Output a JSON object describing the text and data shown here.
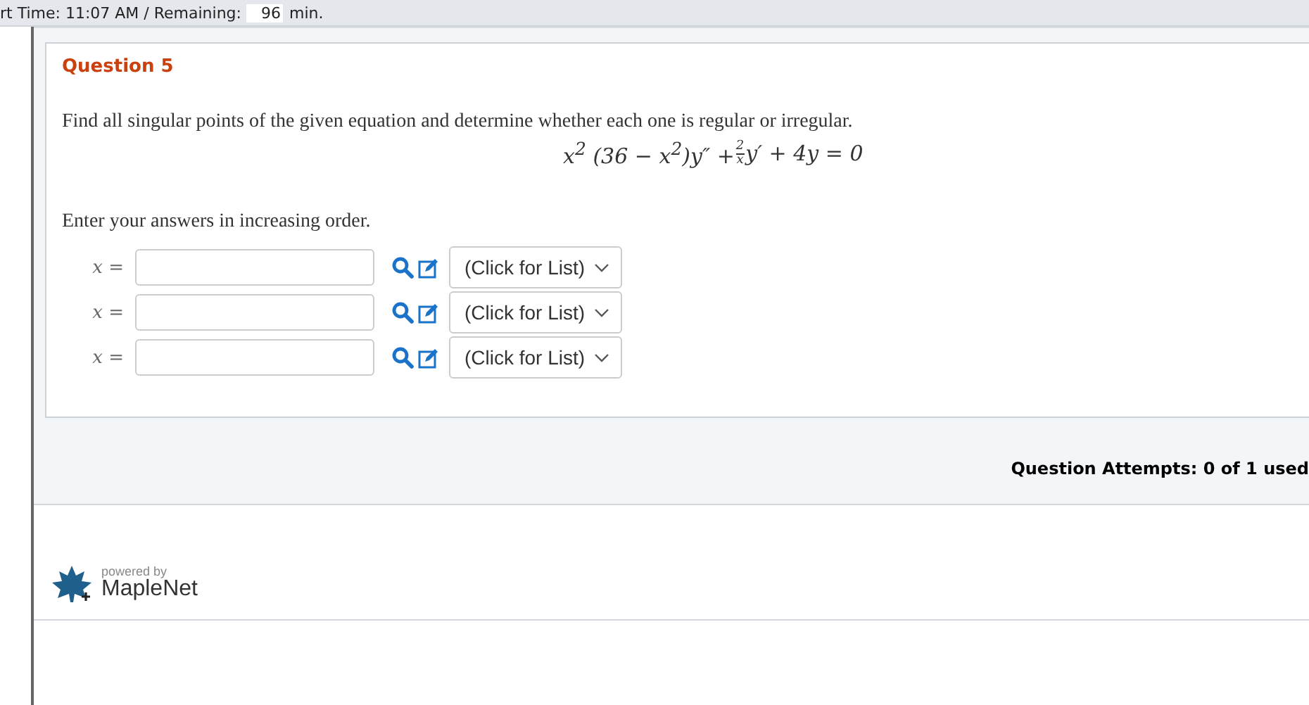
{
  "top_bar": {
    "time_label": "rt Time: 11:07 AM / Remaining:",
    "remaining": "96",
    "unit": "min."
  },
  "question": {
    "title": "Question 5",
    "prompt": "Find all singular points of the given equation and determine whether each one is regular or irregular.",
    "equation": {
      "before": "x$^{2}$ (36 − x$^{2}$)y″ + ",
      "fraction_numerator": "2",
      "fraction_denominator": "x",
      "after": "y′ + 4y = 0"
    },
    "instruction": "Enter your answers in increasing order.",
    "answers": [
      {
        "label": "x =",
        "dropdown": "(Click for List)"
      },
      {
        "label": "x =",
        "dropdown": "(Click for List)"
      },
      {
        "label": "x =",
        "dropdown": "(Click for List)"
      }
    ]
  },
  "attempts": "Question Attempts: 0 of 1 used",
  "footer": {
    "powered_by": "powered by",
    "brand": "MapleNet"
  }
}
